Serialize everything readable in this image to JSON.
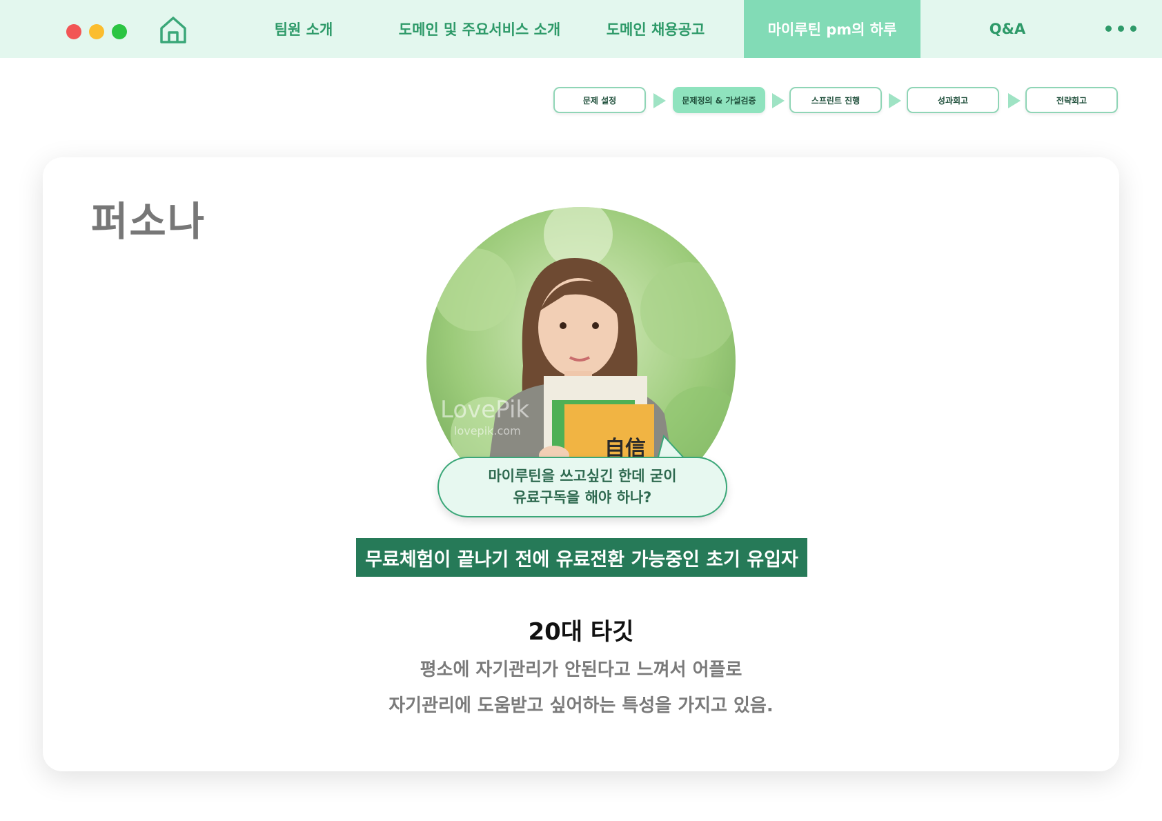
{
  "window": {
    "controls": [
      {
        "name": "close",
        "color": "#f25555"
      },
      {
        "name": "minimize",
        "color": "#fbbd2e"
      },
      {
        "name": "zoom",
        "color": "#2bc542"
      }
    ],
    "home_icon": "home-icon"
  },
  "nav": {
    "items": [
      {
        "label": "팀원 소개",
        "active": false
      },
      {
        "label": "도메인 및 주요서비스 소개",
        "active": false
      },
      {
        "label": "도메인 채용공고",
        "active": false
      },
      {
        "label": "마이루틴 pm의 하루",
        "active": true
      },
      {
        "label": "Q&A",
        "active": false
      }
    ],
    "more_icon": "more-dots-icon"
  },
  "steps": [
    {
      "label": "문제 설정",
      "active": false
    },
    {
      "label": "문제정의 & 가설검증",
      "active": true
    },
    {
      "label": "스프린트 진행",
      "active": false
    },
    {
      "label": "성과회고",
      "active": false
    },
    {
      "label": "전략회고",
      "active": false
    }
  ],
  "persona": {
    "title": "퍼소나",
    "photo_watermark": "LovePik",
    "photo_watermark_url": "lovepik.com",
    "book_text": "自信",
    "bubble_line1": "마이루틴을 쓰고싶긴 한데 굳이",
    "bubble_line2": "유료구독을 해야 하나?",
    "banner": "무료체험이 끝나기 전에 유료전환 가능중인 초기 유입자",
    "target": "20대 타깃",
    "desc_line1": "평소에 자기관리가 안된다고 느껴서 어플로",
    "desc_line2": "자기관리에 도움받고 싶어하는 특성을 가지고 있음."
  },
  "colors": {
    "nav_bg": "#e3f7ee",
    "nav_active": "#82dbb6",
    "nav_text": "#2e9a69",
    "banner": "#267a58",
    "bubble_border": "#3aa778"
  }
}
